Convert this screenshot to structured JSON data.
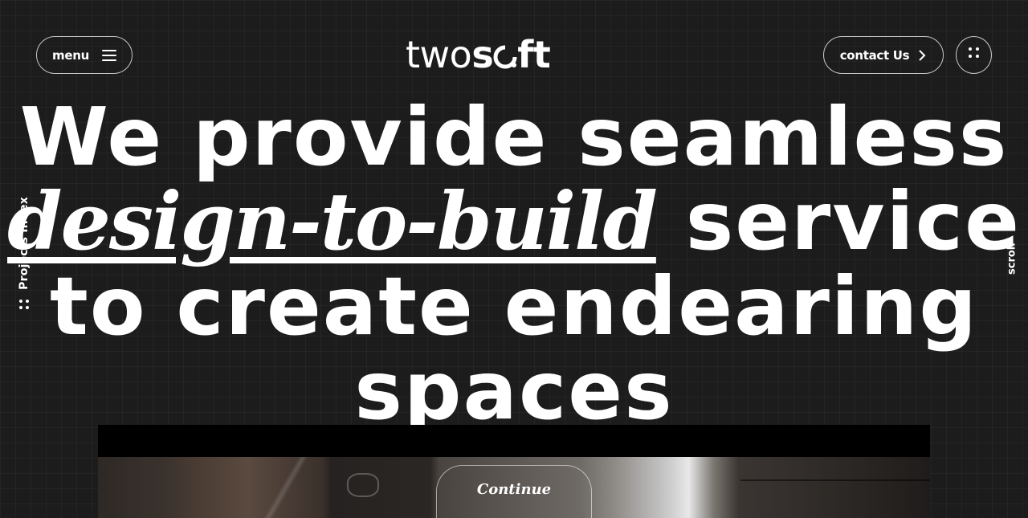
{
  "header": {
    "menu_label": "menu",
    "logo_part1": "two",
    "logo_part2": "s",
    "logo_part3": "ft",
    "contact_label": "contact Us"
  },
  "side": {
    "projects_index_label": "Projects Index",
    "scroll_label": "scroll"
  },
  "hero": {
    "line1": "We provide seamless",
    "line2_italic": "design-to-build",
    "line2_rest": "service",
    "line3": "to create endearing",
    "line4": "spaces"
  },
  "cta": {
    "continue_label": "Continue"
  },
  "colors": {
    "background": "#1c1c1c",
    "text": "#ffffff",
    "band": "#000000"
  },
  "icons": [
    "hamburger-icon",
    "chevron-right-icon",
    "dots-grid-icon",
    "logo-o-icon"
  ]
}
